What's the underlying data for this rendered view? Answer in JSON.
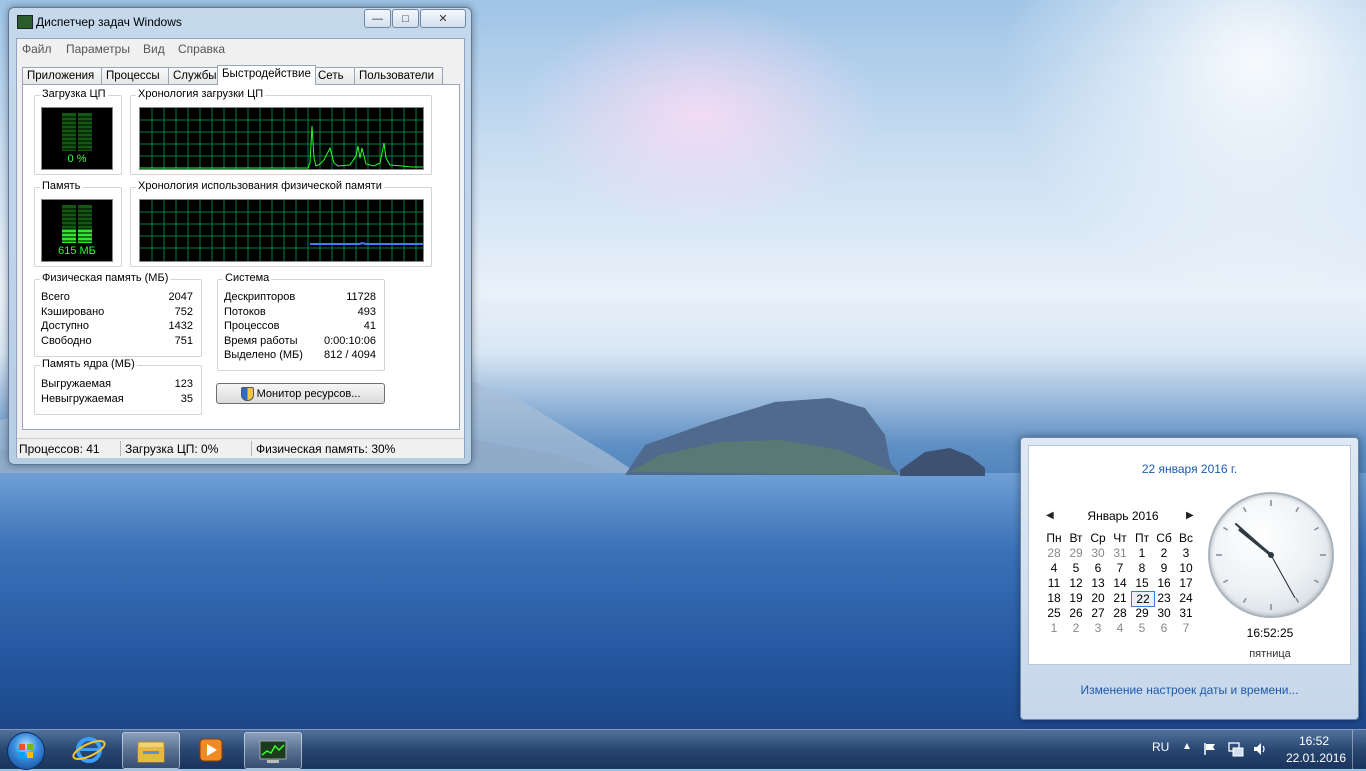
{
  "task_manager": {
    "title": "Диспетчер задач Windows",
    "window_controls": {
      "minimize": "—",
      "maximize": "□",
      "close": "✕"
    },
    "menu": [
      "Файл",
      "Параметры",
      "Вид",
      "Справка"
    ],
    "tabs": [
      "Приложения",
      "Процессы",
      "Службы",
      "Быстродействие",
      "Сеть",
      "Пользователи"
    ],
    "active_tab": "Быстродействие",
    "cpu_usage_title": "Загрузка ЦП",
    "cpu_usage_value": "0 %",
    "cpu_history_title": "Хронология загрузки ЦП",
    "memory_title": "Память",
    "memory_value": "615 МБ",
    "memory_history_title": "Хронология использования физической памяти",
    "physical_memory": {
      "title": "Физическая память (МБ)",
      "rows": [
        {
          "label": "Всего",
          "value": "2047"
        },
        {
          "label": "Кэшировано",
          "value": "752"
        },
        {
          "label": "Доступно",
          "value": "1432"
        },
        {
          "label": "Свободно",
          "value": "751"
        }
      ]
    },
    "kernel_memory": {
      "title": "Память ядра (МБ)",
      "rows": [
        {
          "label": "Выгружаемая",
          "value": "123"
        },
        {
          "label": "Невыгружаемая",
          "value": "35"
        }
      ]
    },
    "system": {
      "title": "Система",
      "rows": [
        {
          "label": "Дескрипторов",
          "value": "11728"
        },
        {
          "label": "Потоков",
          "value": "493"
        },
        {
          "label": "Процессов",
          "value": "41"
        },
        {
          "label": "Время работы",
          "value": "0:00:10:06"
        },
        {
          "label": "Выделено (МБ)",
          "value": "812 / 4094"
        }
      ]
    },
    "resource_monitor_button": "Монитор ресурсов...",
    "status": {
      "processes": "Процессов: 41",
      "cpu": "Загрузка ЦП: 0%",
      "memory": "Физическая память: 30%"
    },
    "colors": {
      "graph_line": "#22ff22",
      "memory_line": "#3a7bff",
      "grid": "#008040"
    }
  },
  "clock_flyout": {
    "date_long": "22 января 2016 г.",
    "prev_icon": "◀",
    "next_icon": "▶",
    "month": "Январь 2016",
    "weekdays": [
      "Пн",
      "Вт",
      "Ср",
      "Чт",
      "Пт",
      "Сб",
      "Вс"
    ],
    "weeks": [
      [
        "28",
        "29",
        "30",
        "31",
        "1",
        "2",
        "3"
      ],
      [
        "4",
        "5",
        "6",
        "7",
        "8",
        "9",
        "10"
      ],
      [
        "11",
        "12",
        "13",
        "14",
        "15",
        "16",
        "17"
      ],
      [
        "18",
        "19",
        "20",
        "21",
        "22",
        "23",
        "24"
      ],
      [
        "25",
        "26",
        "27",
        "28",
        "29",
        "30",
        "31"
      ],
      [
        "1",
        "2",
        "3",
        "4",
        "5",
        "6",
        "7"
      ]
    ],
    "today": "22",
    "time": "16:52:25",
    "weekday": "пятница",
    "settings_link": "Изменение настроек даты и времени..."
  },
  "taskbar": {
    "language": "RU",
    "time": "16:52",
    "date": "22.01.2016",
    "tray_icons": [
      "show-hidden-icon",
      "action-center-flag-icon",
      "network-icon",
      "volume-icon"
    ],
    "pinned": [
      "internet-explorer-icon",
      "explorer-folder-icon",
      "media-player-icon",
      "task-manager-icon"
    ]
  }
}
